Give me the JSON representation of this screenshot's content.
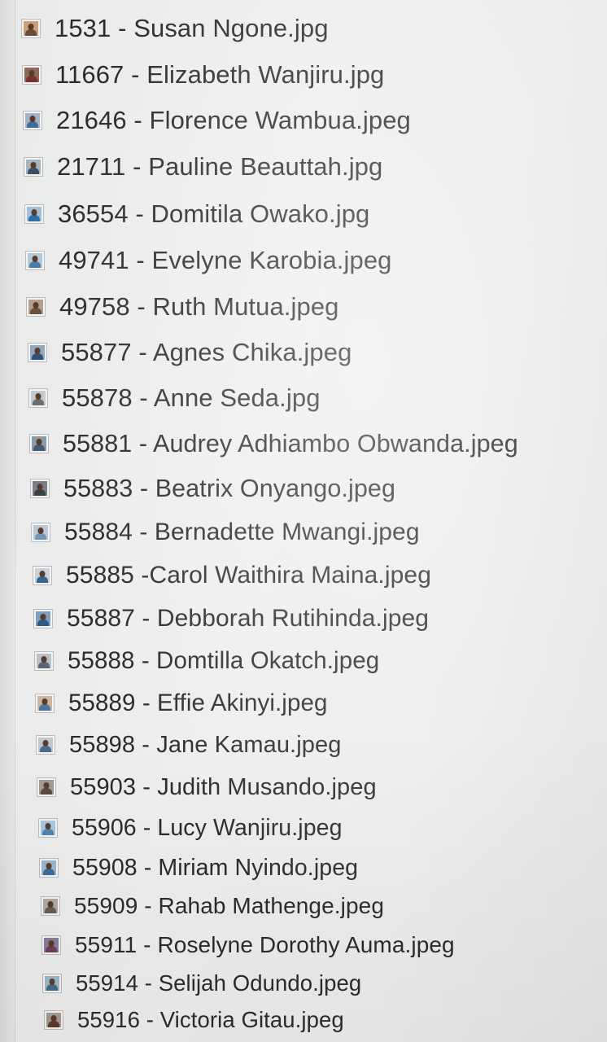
{
  "file_list": {
    "items": [
      {
        "label": "1531 - Susan Ngone.jpg",
        "icon": "image-thumbnail-icon"
      },
      {
        "label": "11667 - Elizabeth Wanjiru.jpg",
        "icon": "image-thumbnail-icon"
      },
      {
        "label": "21646 - Florence Wambua.jpeg",
        "icon": "image-thumbnail-icon"
      },
      {
        "label": "21711 - Pauline Beauttah.jpg",
        "icon": "image-thumbnail-icon"
      },
      {
        "label": "36554 - Domitila Owako.jpg",
        "icon": "image-thumbnail-icon"
      },
      {
        "label": "49741 - Evelyne Karobia.jpeg",
        "icon": "image-thumbnail-icon"
      },
      {
        "label": "49758 - Ruth Mutua.jpeg",
        "icon": "image-thumbnail-icon"
      },
      {
        "label": "55877 - Agnes Chika.jpeg",
        "icon": "image-thumbnail-icon"
      },
      {
        "label": "55878 - Anne Seda.jpg",
        "icon": "image-thumbnail-icon"
      },
      {
        "label": "55881 - Audrey Adhiambo Obwanda.jpeg",
        "icon": "image-thumbnail-icon"
      },
      {
        "label": "55883 - Beatrix Onyango.jpeg",
        "icon": "image-thumbnail-icon"
      },
      {
        "label": "55884 - Bernadette Mwangi.jpeg",
        "icon": "image-thumbnail-icon"
      },
      {
        "label": "55885 -Carol Waithira Maina.jpeg",
        "icon": "image-thumbnail-icon"
      },
      {
        "label": "55887 - Debborah Rutihinda.jpeg",
        "icon": "image-thumbnail-icon"
      },
      {
        "label": "55888 - Domtilla Okatch.jpeg",
        "icon": "image-thumbnail-icon"
      },
      {
        "label": "55889 - Effie Akinyi.jpeg",
        "icon": "image-thumbnail-icon"
      },
      {
        "label": "55898 - Jane Kamau.jpeg",
        "icon": "image-thumbnail-icon"
      },
      {
        "label": "55903 - Judith Musando.jpeg",
        "icon": "image-thumbnail-icon"
      },
      {
        "label": "55906 - Lucy Wanjiru.jpeg",
        "icon": "image-thumbnail-icon"
      },
      {
        "label": "55908 - Miriam Nyindo.jpeg",
        "icon": "image-thumbnail-icon"
      },
      {
        "label": "55909 - Rahab Mathenge.jpeg",
        "icon": "image-thumbnail-icon"
      },
      {
        "label": "55911 - Roselyne Dorothy Auma.jpeg",
        "icon": "image-thumbnail-icon"
      },
      {
        "label": "55914 - Selijah Odundo.jpeg",
        "icon": "image-thumbnail-icon"
      },
      {
        "label": "55916 - Victoria Gitau.jpeg",
        "icon": "image-thumbnail-icon"
      }
    ]
  },
  "colors": {
    "background": "#ececeb",
    "text": "#2a2b2d",
    "thumbnail_border": "#b9bcbe"
  }
}
